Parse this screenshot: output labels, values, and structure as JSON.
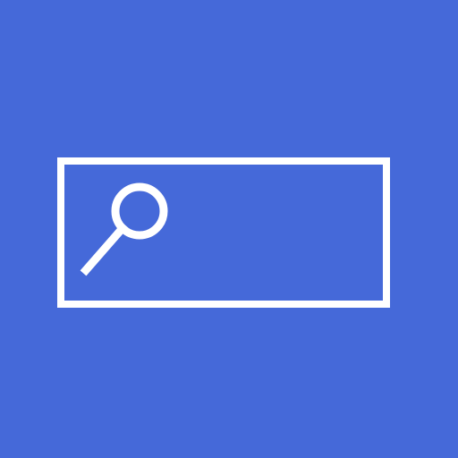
{
  "search": {
    "icon": "search-icon",
    "value": "",
    "placeholder": ""
  },
  "colors": {
    "background": "#4569d9",
    "foreground": "#ffffff"
  }
}
